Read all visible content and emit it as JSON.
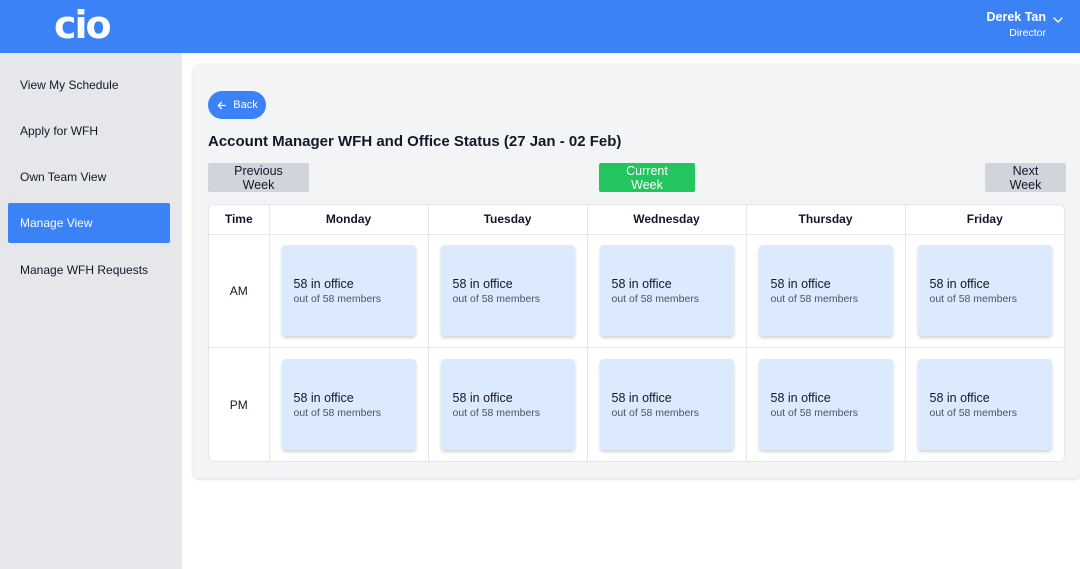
{
  "header": {
    "logo_text": "cio",
    "user_name": "Derek Tan",
    "user_role": "Director",
    "brand_color": "#3b82f6"
  },
  "sidebar": {
    "items": [
      {
        "label": "View My Schedule",
        "active": false
      },
      {
        "label": "Apply for WFH",
        "active": false
      },
      {
        "label": "Own Team View",
        "active": false
      },
      {
        "label": "Manage View",
        "active": true
      },
      {
        "label": "Manage WFH Requests",
        "active": false
      }
    ]
  },
  "main": {
    "back_label": "Back",
    "title": "Account Manager WFH and Office Status (27 Jan - 02 Feb)",
    "prev_week_label": "Previous Week",
    "current_week_label": "Current Week",
    "next_week_label": "Next Week",
    "table": {
      "headers": [
        "Time",
        "Monday",
        "Tuesday",
        "Wednesday",
        "Thursday",
        "Friday"
      ],
      "rows": [
        {
          "time": "AM",
          "cells": [
            {
              "main": "58 in office",
              "sub": "out of 58 members"
            },
            {
              "main": "58 in office",
              "sub": "out of 58 members"
            },
            {
              "main": "58 in office",
              "sub": "out of 58 members"
            },
            {
              "main": "58 in office",
              "sub": "out of 58 members"
            },
            {
              "main": "58 in office",
              "sub": "out of 58 members"
            }
          ]
        },
        {
          "time": "PM",
          "cells": [
            {
              "main": "58 in office",
              "sub": "out of 58 members"
            },
            {
              "main": "58 in office",
              "sub": "out of 58 members"
            },
            {
              "main": "58 in office",
              "sub": "out of 58 members"
            },
            {
              "main": "58 in office",
              "sub": "out of 58 members"
            },
            {
              "main": "58 in office",
              "sub": "out of 58 members"
            }
          ]
        }
      ]
    }
  }
}
